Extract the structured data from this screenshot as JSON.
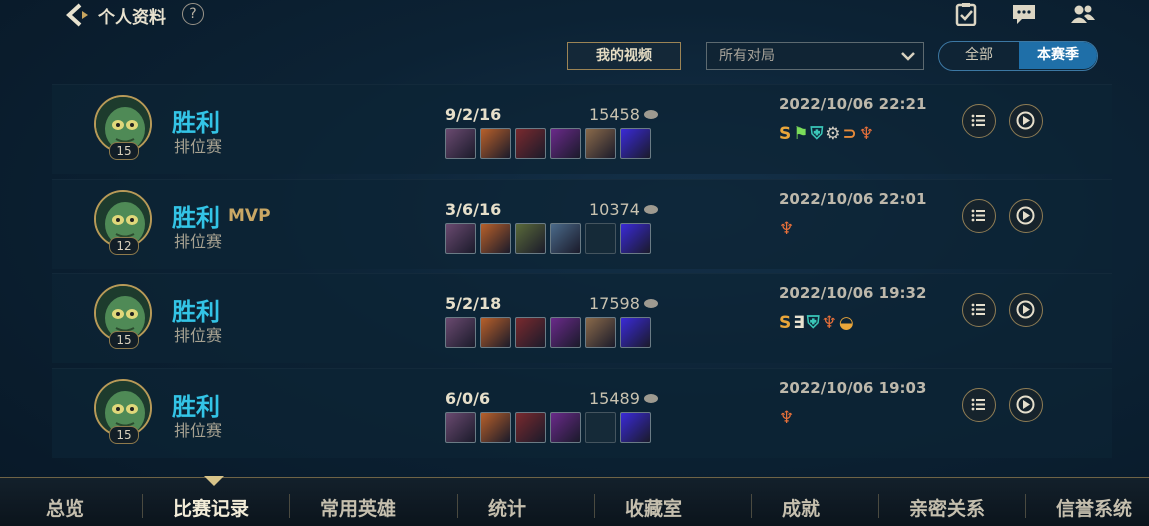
{
  "header": {
    "title": "个人资料",
    "help": "?"
  },
  "controls": {
    "my_video_label": "我的视频",
    "filter_value": "所有对局",
    "segment": {
      "all_label": "全部",
      "season_label": "本赛季",
      "selected": "本赛季"
    }
  },
  "matches": [
    {
      "result": "胜利",
      "mvp": "",
      "mode": "排位赛",
      "level": "15",
      "kda": "9/2/16",
      "gold": "15458",
      "items": [
        "#6a4a70",
        "#b8602a",
        "#7a2a2e",
        "#6a2a8a",
        "#8a6a4a",
        "#3a2ad8"
      ],
      "date": "2022/10/06 22:21",
      "badges": [
        {
          "t": "S",
          "c": "#e9a63a"
        },
        {
          "t": "⚑",
          "c": "#7adc5a"
        },
        {
          "t": "⛨",
          "c": "#3ac7b8"
        },
        {
          "t": "⚙",
          "c": "#d0cbc0"
        },
        {
          "t": "⊃",
          "c": "#e68a3a"
        },
        {
          "t": "♆",
          "c": "#e8703a"
        }
      ]
    },
    {
      "result": "胜利",
      "mvp": "MVP",
      "mode": "排位赛",
      "level": "12",
      "kda": "3/6/16",
      "gold": "10374",
      "items": [
        "#6a4a70",
        "#b8602a",
        "#5a6a3a",
        "#4a6a8a",
        "",
        "#3a2ad8"
      ],
      "date": "2022/10/06 22:01",
      "badges": [
        {
          "t": "♆",
          "c": "#e8703a"
        }
      ]
    },
    {
      "result": "胜利",
      "mvp": "",
      "mode": "排位赛",
      "level": "15",
      "kda": "5/2/18",
      "gold": "17598",
      "items": [
        "#6a4a70",
        "#b8602a",
        "#7a2a2e",
        "#6a2a8a",
        "#8a6a4a",
        "#3a2ad8"
      ],
      "date": "2022/10/06 19:32",
      "badges": [
        {
          "t": "S",
          "c": "#e9a63a"
        },
        {
          "t": "∃",
          "c": "#e8e2d0"
        },
        {
          "t": "⛨",
          "c": "#3ac7b8"
        },
        {
          "t": "♆",
          "c": "#e8703a"
        },
        {
          "t": "◒",
          "c": "#e9a63a"
        }
      ]
    },
    {
      "result": "胜利",
      "mvp": "",
      "mode": "排位赛",
      "level": "15",
      "kda": "6/0/6",
      "gold": "15489",
      "items": [
        "#6a4a70",
        "#b8602a",
        "#7a2a2e",
        "#6a2a8a",
        "",
        "#3a2ad8"
      ],
      "date": "2022/10/06 19:03",
      "badges": [
        {
          "t": "♆",
          "c": "#e8703a"
        }
      ]
    }
  ],
  "nav": {
    "items": [
      "总览",
      "比赛记录",
      "常用英雄",
      "统计",
      "收藏室",
      "成就",
      "亲密关系",
      "信誉系统"
    ],
    "active": "比赛记录"
  }
}
